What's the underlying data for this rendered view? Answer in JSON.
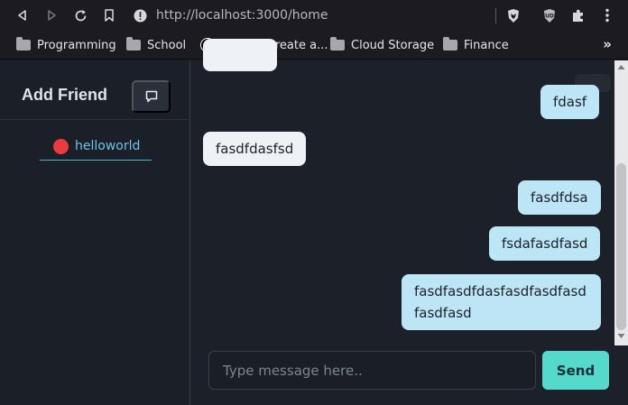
{
  "browser": {
    "url": "http://localhost:3000/home",
    "bookmarks": [
      {
        "label": "Programming",
        "icon": "folder-icon"
      },
      {
        "label": "School",
        "icon": "folder-icon"
      },
      {
        "label": "Setup - Create a...",
        "icon": "notion-icon"
      },
      {
        "label": "Cloud Storage",
        "icon": "folder-icon"
      },
      {
        "label": "Finance",
        "icon": "folder-icon"
      }
    ],
    "overflow": "»",
    "notion_letter": "N"
  },
  "sidebar": {
    "title": "Add Friend",
    "friends": [
      {
        "name": "helloworld",
        "status_color": "#ea3b3f"
      }
    ]
  },
  "messages": [
    {
      "text": "fdasf",
      "side": "out"
    },
    {
      "text": "fasdfdasfsd",
      "side": "in"
    },
    {
      "text": "fasdfdsa",
      "side": "out"
    },
    {
      "text": "fsdafasdfasd",
      "side": "out"
    },
    {
      "text": "fasdfasdfdasfasdfasdfasd",
      "text2": "fasdfasd",
      "side": "out"
    }
  ],
  "composer": {
    "placeholder": "Type message here..",
    "send_label": "Send"
  },
  "colors": {
    "accent": "#54d9cb",
    "link": "#6ec3e5",
    "out_bubble": "#bce6f6",
    "in_bubble": "#eef1f6"
  }
}
